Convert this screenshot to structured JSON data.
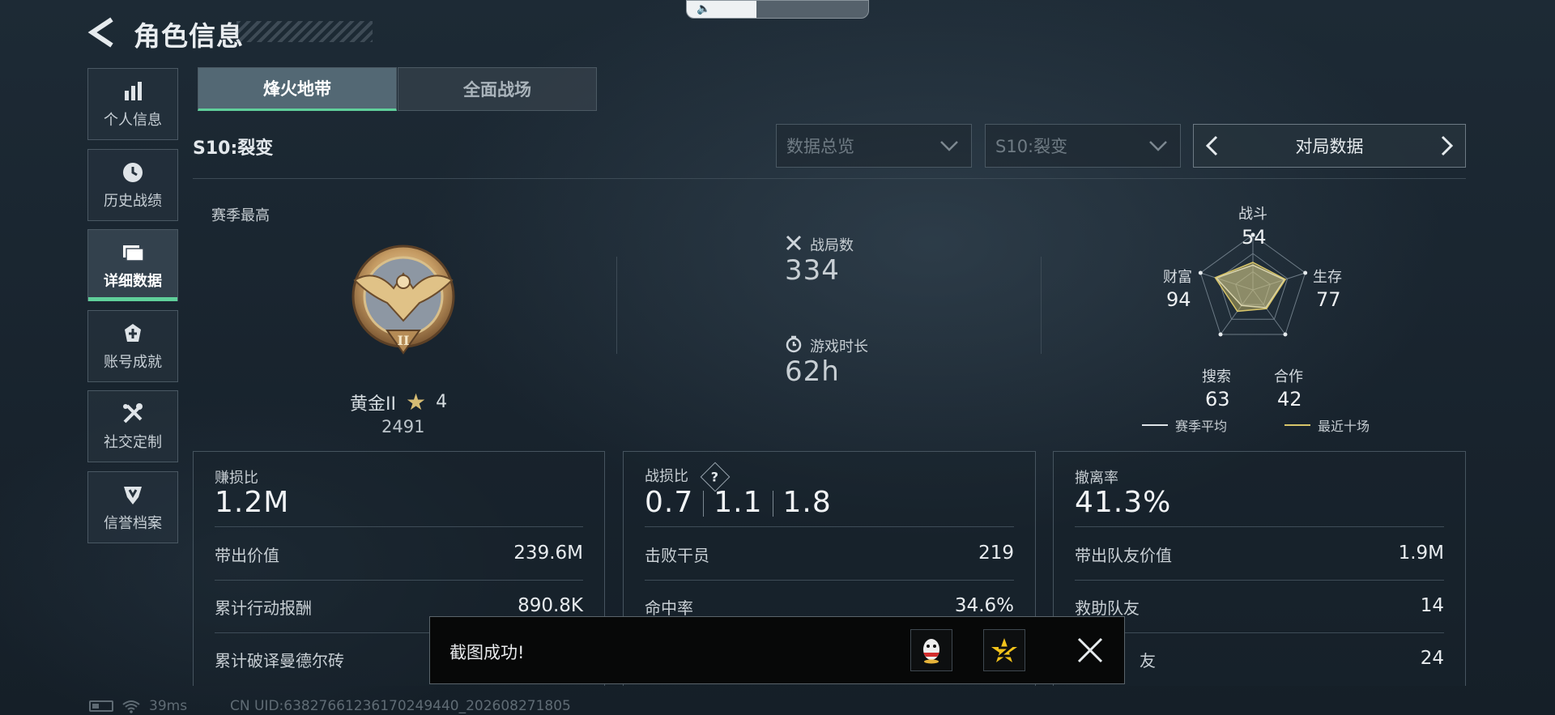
{
  "header": {
    "title": "角色信息"
  },
  "sidebar": {
    "items": [
      {
        "label": "个人信息",
        "icon": "bar-chart-icon"
      },
      {
        "label": "历史战绩",
        "icon": "clock-icon"
      },
      {
        "label": "详细数据",
        "icon": "folder-icon",
        "active": true
      },
      {
        "label": "账号成就",
        "icon": "badge-icon"
      },
      {
        "label": "社交定制",
        "icon": "tools-icon"
      },
      {
        "label": "信誉档案",
        "icon": "shield-icon"
      }
    ]
  },
  "tabs": [
    {
      "label": "烽火地带",
      "active": true
    },
    {
      "label": "全面战场",
      "active": false
    }
  ],
  "season_label": "S10:裂变",
  "filters": {
    "overview": "数据总览",
    "season": "S10:裂变",
    "match_data": "对局数据"
  },
  "season_best": {
    "label": "赛季最高",
    "rank": "黄金II",
    "stars": "4",
    "score": "2491",
    "badge_roman": "II"
  },
  "matches": {
    "label": "战局数",
    "value": "334"
  },
  "playtime": {
    "label": "游戏时长",
    "value": "62h"
  },
  "radar": {
    "axes": [
      {
        "label": "战斗",
        "value": "54"
      },
      {
        "label": "生存",
        "value": "77"
      },
      {
        "label": "合作",
        "value": "42"
      },
      {
        "label": "搜索",
        "value": "63"
      },
      {
        "label": "财富",
        "value": "94"
      }
    ],
    "season_avg": [
      0.45,
      0.6,
      0.4,
      0.35,
      0.7
    ],
    "recent_ten": [
      0.5,
      0.62,
      0.42,
      0.48,
      0.72
    ],
    "legend": {
      "season_avg": "赛季平均",
      "recent_ten": "最近十场"
    }
  },
  "cards": [
    {
      "title": "赚损比",
      "value": "1.2M",
      "rows": [
        {
          "k": "带出价值",
          "v": "239.6M"
        },
        {
          "k": "累计行动报酬",
          "v": "890.8K"
        },
        {
          "k": "累计破译曼德尔砖",
          "v": ""
        }
      ]
    },
    {
      "title": "战损比",
      "q": "?",
      "values": [
        "0.7",
        "1.1",
        "1.8"
      ],
      "rows": [
        {
          "k": "击败干员",
          "v": "219"
        },
        {
          "k": "命中率",
          "v": "34.6%"
        }
      ]
    },
    {
      "title": "撤离率",
      "value": "41.3%",
      "rows": [
        {
          "k": "带出队友价值",
          "v": "1.9M"
        },
        {
          "k": "救助队友",
          "v": "14"
        },
        {
          "k": "友",
          "v": "24"
        }
      ]
    }
  ],
  "toast": {
    "message": "截图成功!"
  },
  "footer": {
    "ping": "39ms",
    "uid": "CN UID:63827661236170249440_202608271805"
  },
  "colors": {
    "accent": "#5fcf9a",
    "radar_recent": "#d8c56a"
  }
}
